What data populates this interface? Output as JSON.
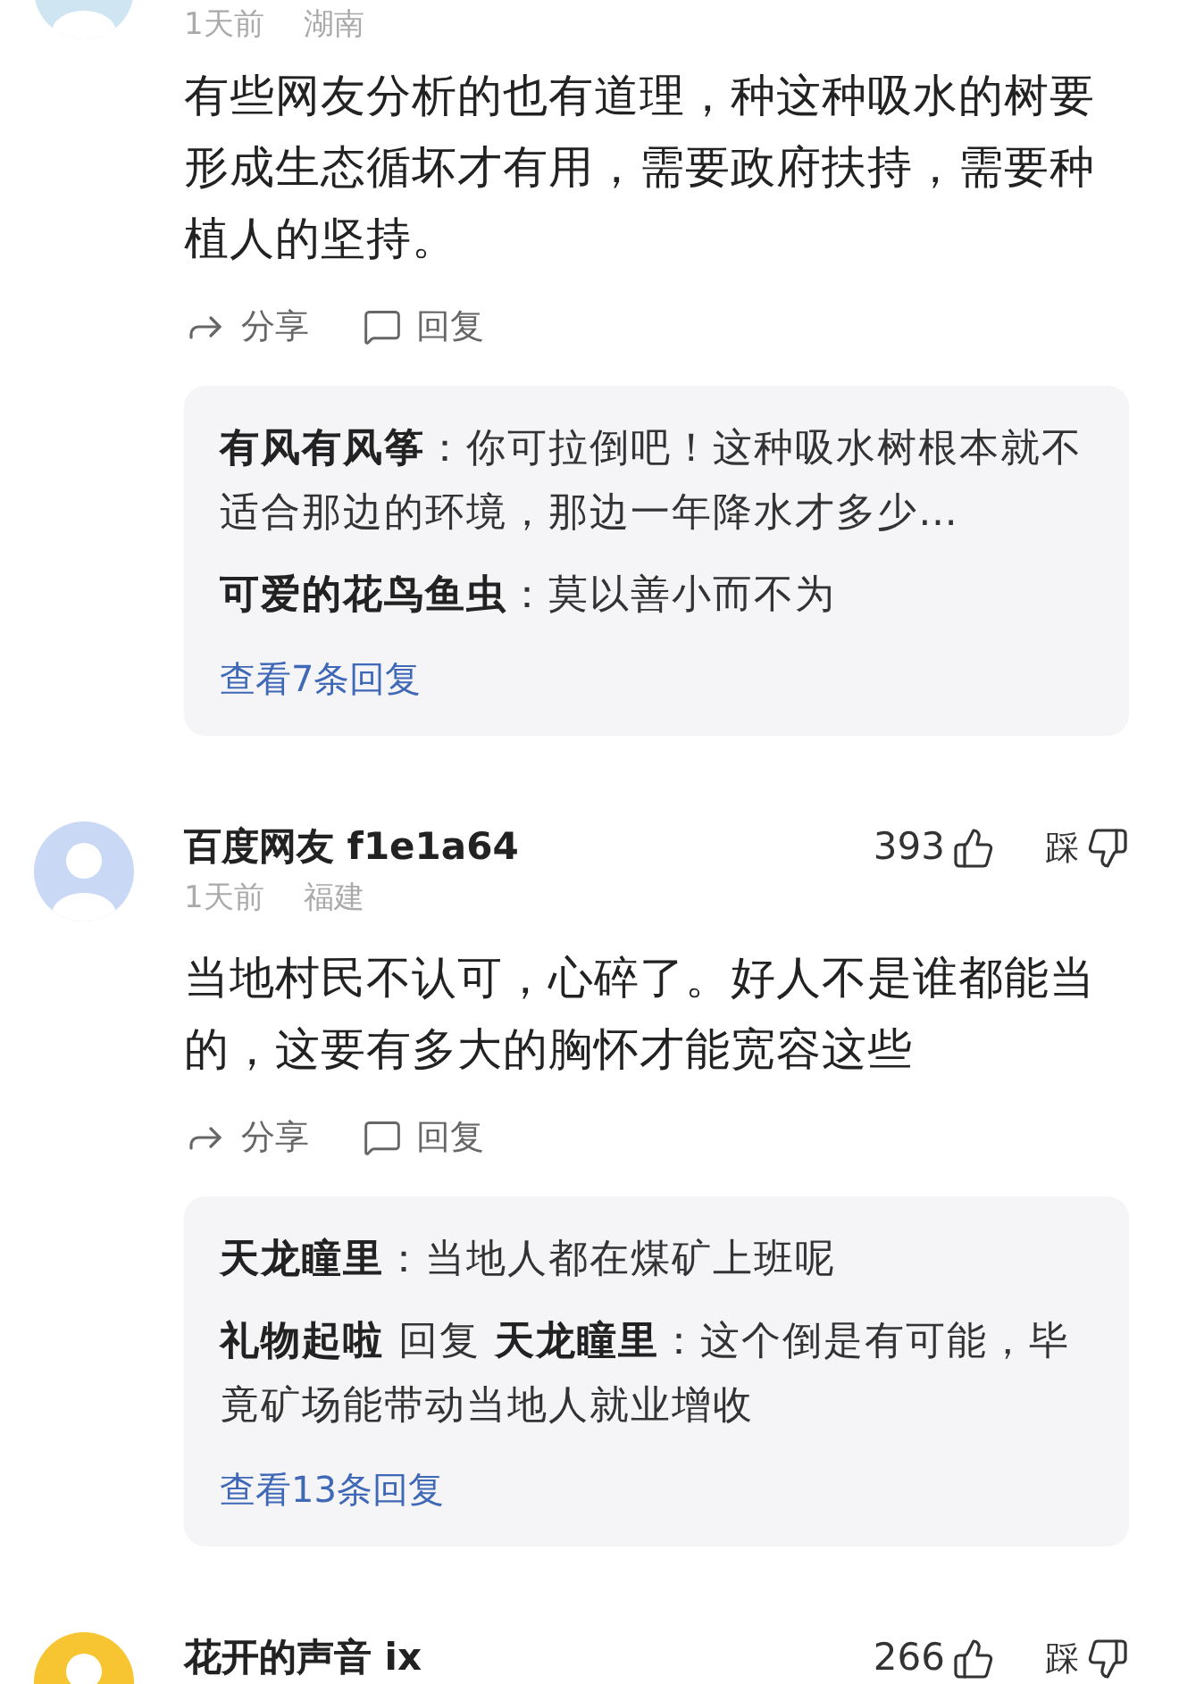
{
  "comments": [
    {
      "avatar": {
        "color": "#cfe6f2"
      },
      "meta": {
        "time": "1天前",
        "location": "湖南"
      },
      "text": "有些网友分析的也有道理，种这种吸水的树要形成生态循坏才有用，需要政府扶持，需要种植人的坚持。",
      "actions": [
        {
          "kind": "share",
          "label": "分享"
        },
        {
          "kind": "reply",
          "label": "回复"
        }
      ],
      "replies": {
        "items": [
          {
            "author": "有风有风筝",
            "sep": "：",
            "text": "你可拉倒吧！这种吸水树根本就不适合那边的环境，那边一年降水才多少…"
          },
          {
            "author": "可爱的花鸟鱼虫",
            "sep": "：",
            "text": "莫以善小而不为"
          }
        ],
        "more": "查看7条回复"
      }
    },
    {
      "avatar": {
        "color": "#c9d9f5"
      },
      "user": "百度网友 f1e1a64",
      "likes": "393",
      "dislike": "踩",
      "meta": {
        "time": "1天前",
        "location": "福建"
      },
      "text": "当地村民不认可，心碎了。好人不是谁都能当的，这要有多大的胸怀才能宽容这些",
      "actions": [
        {
          "kind": "share",
          "label": "分享"
        },
        {
          "kind": "reply",
          "label": "回复"
        }
      ],
      "replies": {
        "items": [
          {
            "author": "天龙瞳里",
            "sep": "：",
            "text": "当地人都在煤矿上班呢"
          },
          {
            "author": "礼物起啦",
            "reply_word": "回复",
            "reply_to": "天龙瞳里",
            "sep": "：",
            "text": "这个倒是有可能，毕竟矿场能带动当地人就业增收"
          }
        ],
        "more": "查看13条回复"
      }
    },
    {
      "avatar": {
        "color": "#f7c531"
      },
      "user": "花开的声音 ix",
      "likes": "266",
      "dislike": "踩"
    }
  ]
}
